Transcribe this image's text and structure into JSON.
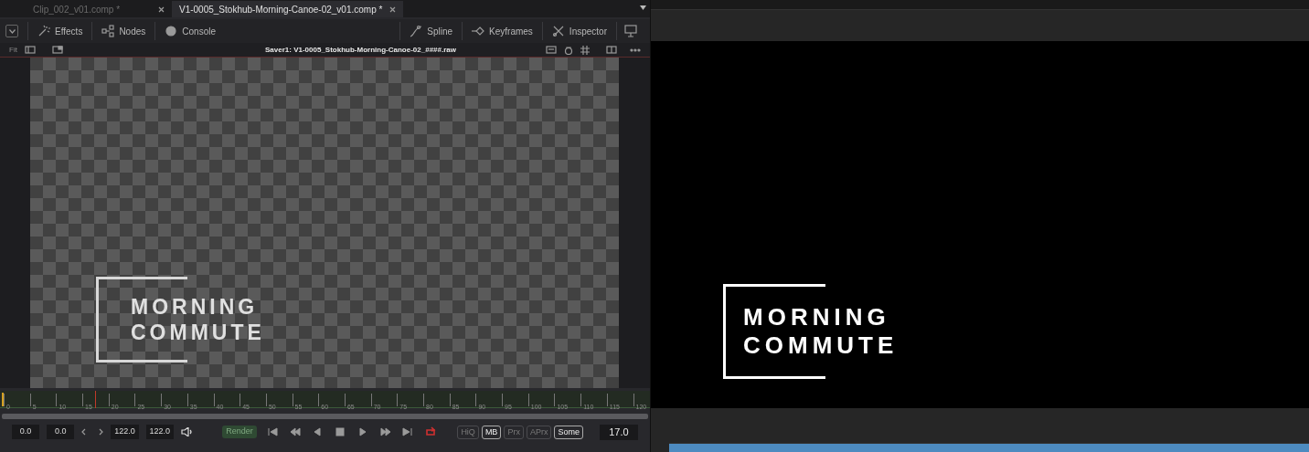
{
  "tabs": [
    {
      "label": "Clip_002_v01.comp *",
      "selected": false
    },
    {
      "label": "V1-0005_Stokhub-Morning-Canoe-02_v01.comp *",
      "selected": true
    }
  ],
  "toolbar": {
    "left": [
      {
        "kind": "effects",
        "label": "Effects"
      },
      {
        "kind": "nodes",
        "label": "Nodes"
      },
      {
        "kind": "console",
        "label": "Console"
      }
    ],
    "right": [
      {
        "kind": "spline",
        "label": "Spline"
      },
      {
        "kind": "keyframes",
        "label": "Keyframes"
      },
      {
        "kind": "inspector",
        "label": "Inspector"
      }
    ]
  },
  "viewer": {
    "fit": "Fit",
    "title": "Saver1: V1-0005_Stokhub-Morning-Canoe-02_####.raw",
    "title_card": [
      "MORNING",
      "COMMUTE"
    ]
  },
  "ruler": {
    "ticks": [
      "0",
      "5",
      "10",
      "15",
      "20",
      "25",
      "30",
      "35",
      "40",
      "45",
      "50",
      "55",
      "60",
      "65",
      "70",
      "75",
      "80",
      "85",
      "90",
      "95",
      "100",
      "105",
      "110",
      "115",
      "120"
    ]
  },
  "controls": {
    "start_fields": [
      "0.0",
      "0.0"
    ],
    "end_fields": [
      "122.0",
      "122.0"
    ],
    "render": "Render",
    "loop": true,
    "toggles": [
      {
        "label": "HiQ",
        "on": false
      },
      {
        "label": "MB",
        "on": true
      },
      {
        "label": "Prx",
        "on": false
      },
      {
        "label": "APrx",
        "on": false
      },
      {
        "label": "Some",
        "on": true
      }
    ],
    "frame": "17.0"
  },
  "output_viewer": {
    "title_card": [
      "MORNING",
      "COMMUTE"
    ]
  }
}
